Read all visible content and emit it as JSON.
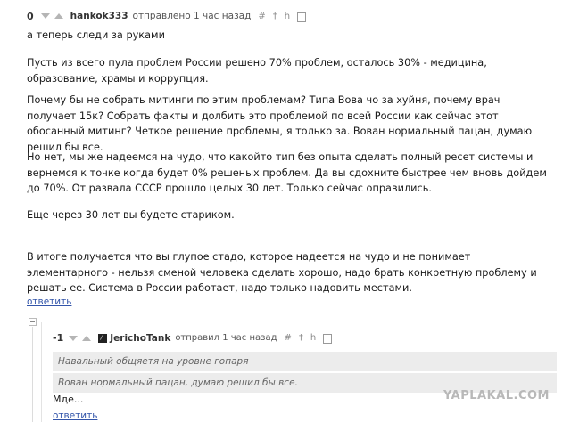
{
  "comment": {
    "score": "0",
    "author": "hankok333",
    "posted": "отправлено 1 час назад",
    "tool_icons": [
      "#",
      "†",
      "h"
    ],
    "paragraphs": [
      "а теперь следи за руками",
      "Пусть из всего пула проблем России решено 70% проблем, осталось 30% - медицина, образование, храмы и коррупция.",
      "Почему бы не собрать митинги по этим проблемам? Типа Вова чо за хуйня, почему врач получает 15к? Собрать факты и долбить это проблемой по всей России как сейчас этот обосанный митинг? Четкое решение проблемы, я только за. Вован нормальный пацан, думаю решил бы все.",
      "Но нет, мы же надеемся на чудо, что какойто тип без опыта сделать полный ресет системы и вернемся к точке когда будет 0% решеных проблем. Да вы сдохните быстрее чем вновь дойдем до 70%. От развала СССР прошло целых 30 лет. Только сейчас оправились.",
      "Еще через 30 лет вы будете стариком.",
      "В итоге получается что вы глупое стадо, которое надеется на чудо и не понимает элементарного - нельзя сменой человека сделать хорошо, надо брать конкретную проблему и решать ее. Система в России работает, надо только надовить местами."
    ],
    "reply_label": "ответить"
  },
  "reply": {
    "score": "-1",
    "author": "JerichoTank",
    "posted": "отправил 1 час назад",
    "tool_icons": [
      "#",
      "†",
      "h"
    ],
    "quotes": [
      "Навальный общяетя на уровне гопаря",
      "Вован нормальный пацан, думаю решил бы все."
    ],
    "text": "Мде...",
    "reply_label": "ответить"
  },
  "watermark": "YAPLAKAL.COM",
  "colors": {
    "link": "#3355aa",
    "quote_bg": "#ececec"
  }
}
